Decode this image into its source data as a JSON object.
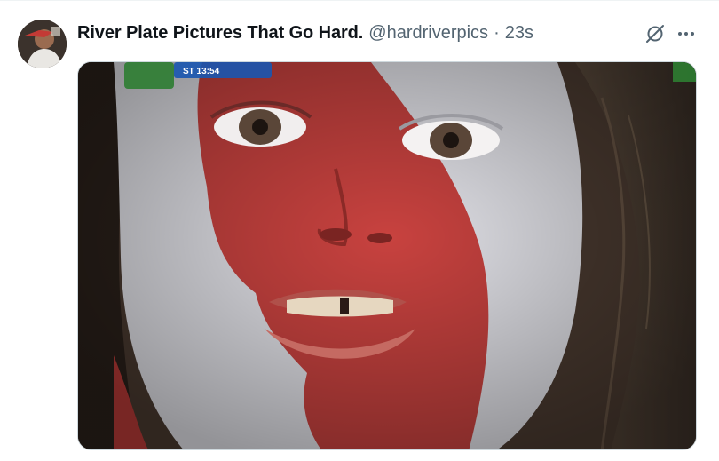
{
  "tweet": {
    "display_name": "River Plate Pictures That Go Hard.",
    "handle": "@hardriverpics",
    "separator": "·",
    "timestamp": "23s",
    "avatar_icon": "user-avatar",
    "grok_icon": "grok-icon",
    "more_icon": "more-dots-icon",
    "media": {
      "scoreboard_text": "ST 13:54"
    }
  },
  "colors": {
    "name_text": "#0f1419",
    "secondary_text": "#536471",
    "border": "#cfd9de",
    "face_red": "#c8423f",
    "face_white": "#e4e4ea"
  }
}
